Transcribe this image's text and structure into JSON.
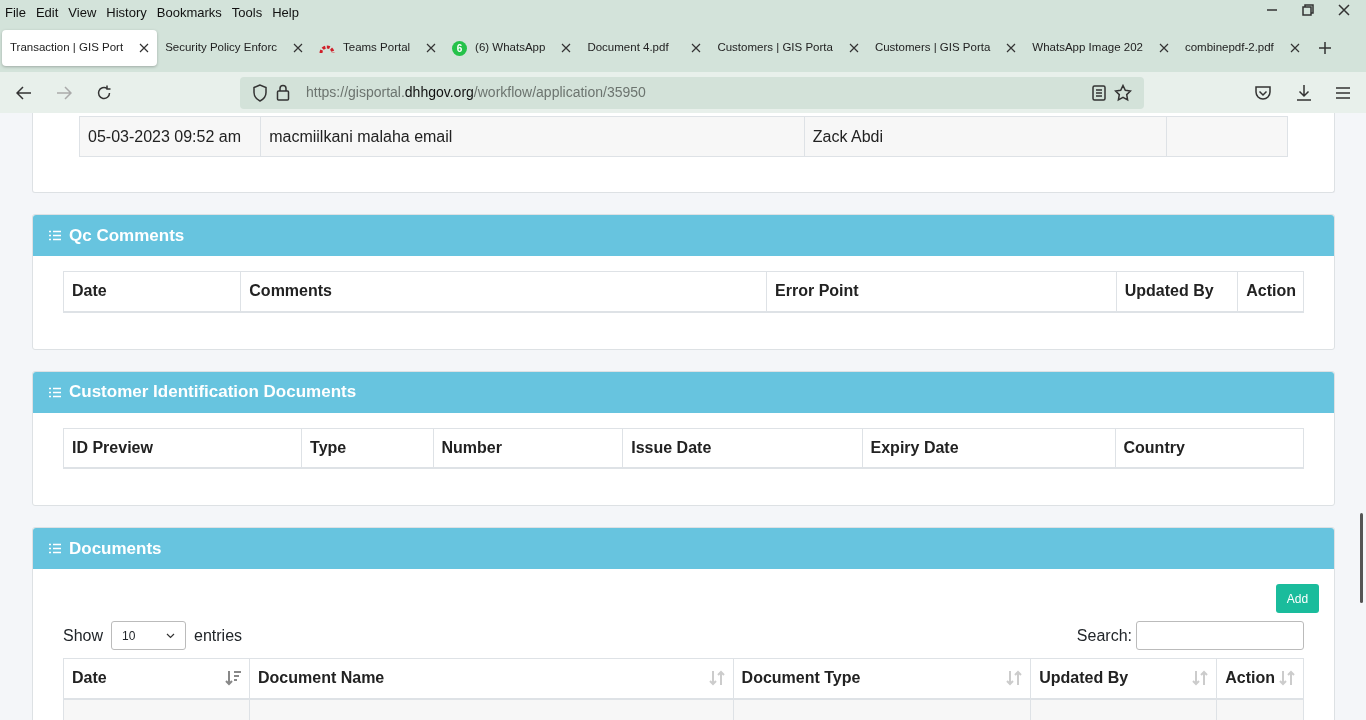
{
  "menu": [
    "File",
    "Edit",
    "View",
    "History",
    "Bookmarks",
    "Tools",
    "Help"
  ],
  "tabs": [
    {
      "label": "Transaction | GIS Port",
      "selected": true
    },
    {
      "label": "Security Policy Enforc",
      "selected": false
    },
    {
      "label": "Teams Portal",
      "selected": false,
      "kind": "arc"
    },
    {
      "label": "(6) WhatsApp",
      "selected": false,
      "kind": "badge",
      "badge": "6"
    },
    {
      "label": "Document 4.pdf",
      "selected": false
    },
    {
      "label": "Customers | GIS Porta",
      "selected": false
    },
    {
      "label": "Customers | GIS Porta",
      "selected": false
    },
    {
      "label": "WhatsApp Image 202",
      "selected": false
    },
    {
      "label": "combinepdf-2.pdf",
      "selected": false
    }
  ],
  "url": {
    "prefix": "https://gisportal.",
    "domain": "dhhgov.org",
    "path": "/workflow/application/35950"
  },
  "history_table": {
    "rows": [
      [
        "05-03-2023 09:52 am",
        "macmiilkani malaha email",
        "Zack Abdi"
      ]
    ]
  },
  "qc_comments": {
    "title": "Qc Comments",
    "columns": [
      "Date",
      "Comments",
      "Error Point",
      "Updated By",
      "Action"
    ]
  },
  "identification": {
    "title": "Customer Identification Documents",
    "columns": [
      "ID Preview",
      "Type",
      "Number",
      "Issue Date",
      "Expiry Date",
      "Country"
    ]
  },
  "documents": {
    "title": "Documents",
    "add_button": "Add",
    "show_label": "Show",
    "page_size": "10",
    "entries_label": "entries",
    "search_label": "Search:",
    "columns": [
      {
        "label": "Date",
        "sorted": true
      },
      {
        "label": "Document Name",
        "sorted": false
      },
      {
        "label": "Document Type",
        "sorted": false
      },
      {
        "label": "Updated By",
        "sorted": false
      },
      {
        "label": "Action",
        "sorted": false
      }
    ]
  }
}
